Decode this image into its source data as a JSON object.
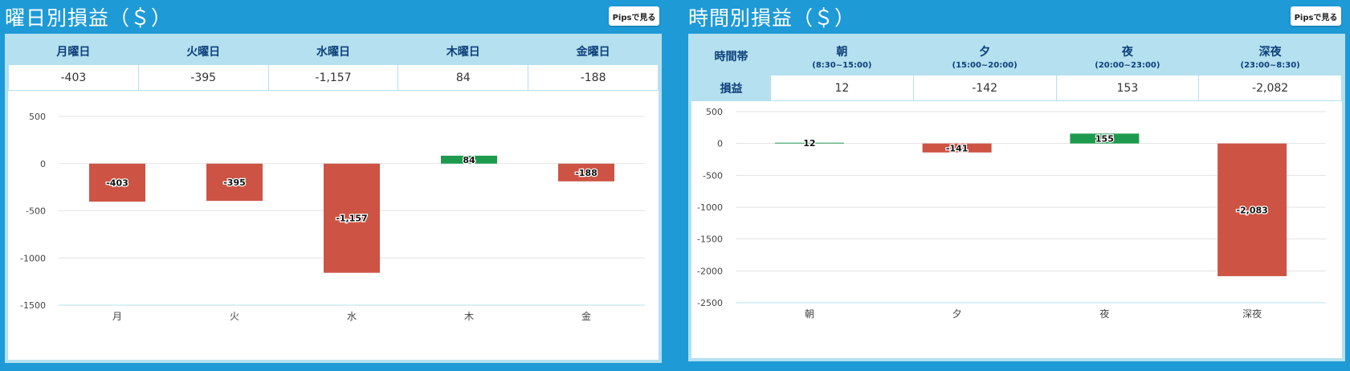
{
  "left": {
    "title": "曜日別損益（＄）",
    "pips_label": "Pipsで見る",
    "headers": [
      "月曜日",
      "火曜日",
      "水曜日",
      "木曜日",
      "金曜日"
    ],
    "values": [
      "-403",
      "-395",
      "-1,157",
      "84",
      "-188"
    ]
  },
  "right": {
    "title": "時間別損益（＄）",
    "pips_label": "Pipsで見る",
    "row_header": "時間帯",
    "value_header": "損益",
    "headers": [
      {
        "label": "朝",
        "range": "(8:30~15:00)"
      },
      {
        "label": "夕",
        "range": "(15:00~20:00)"
      },
      {
        "label": "夜",
        "range": "(20:00~23:00)"
      },
      {
        "label": "深夜",
        "range": "(23:00~8:30)"
      }
    ],
    "values": [
      "12",
      "-142",
      "153",
      "-2,082"
    ]
  },
  "colors": {
    "positive": "#1e9a4e",
    "negative": "#cd5444",
    "accent": "#1e9ad6"
  },
  "chart_data": [
    {
      "type": "bar",
      "categories": [
        "月",
        "火",
        "水",
        "木",
        "金"
      ],
      "values": [
        -403,
        -395,
        -1157,
        84,
        -188
      ],
      "labels": [
        "-403",
        "-395",
        "-1,157",
        "84",
        "-188"
      ],
      "yticks": [
        500,
        0,
        -500,
        -1000,
        -1500
      ],
      "ylim": [
        -1500,
        500
      ],
      "grid": true
    },
    {
      "type": "bar",
      "categories": [
        "朝",
        "夕",
        "夜",
        "深夜"
      ],
      "values": [
        12,
        -141,
        155,
        -2083
      ],
      "labels": [
        "12",
        "-141",
        "155",
        "-2,083"
      ],
      "yticks": [
        500,
        0,
        -500,
        -1000,
        -1500,
        -2000,
        -2500
      ],
      "ylim": [
        -2500,
        500
      ],
      "grid": true
    }
  ]
}
